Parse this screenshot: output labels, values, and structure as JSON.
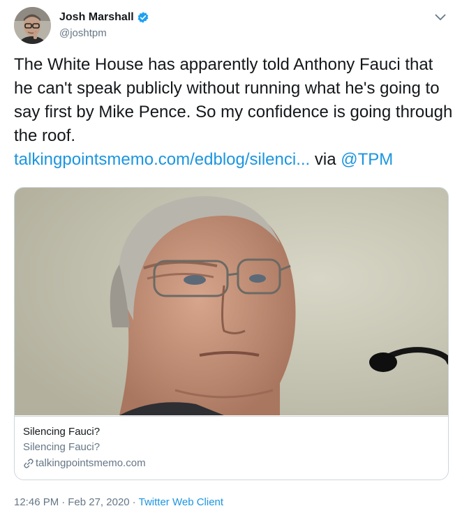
{
  "author": {
    "display_name": "Josh Marshall",
    "handle": "@joshtpm",
    "verified": true,
    "avatar_icon": "user-avatar"
  },
  "tweet": {
    "text_main": "The White House has apparently told Anthony Fauci that he can't speak publicly without running what he's going to say first by Mike Pence. So my confidence is going through the roof.",
    "link_text": "talkingpointsmemo.com/edblog/silenci...",
    "via_text": "via",
    "mention": "@TPM"
  },
  "card": {
    "title": "Silencing Fauci?",
    "description": "Silencing Fauci?",
    "domain": "talkingpointsmemo.com",
    "link_icon": "link-icon"
  },
  "meta": {
    "time": "12:46 PM",
    "separator": "·",
    "date": "Feb 27, 2020",
    "source": "Twitter Web Client"
  },
  "colors": {
    "link": "#1b95e0",
    "secondary_text": "#657786",
    "border": "#ccd6dd",
    "verified": "#1da1f2"
  }
}
